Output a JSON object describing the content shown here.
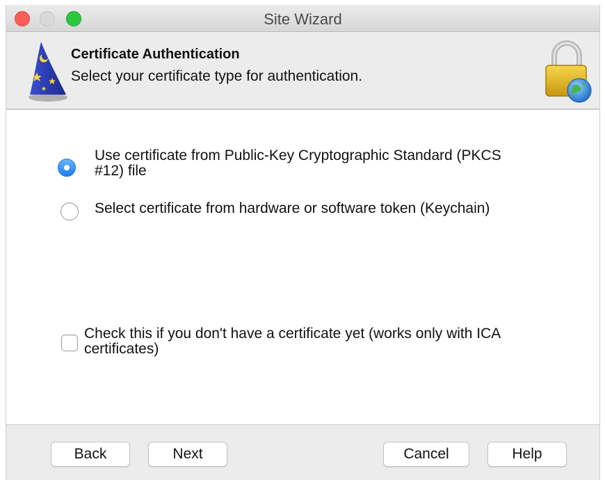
{
  "window": {
    "title": "Site Wizard"
  },
  "header": {
    "title": "Certificate Authentication",
    "subtitle": "Select your certificate type for authentication.",
    "left_icon": "wizard-hat-icon",
    "right_icon": "padlock-globe-icon"
  },
  "options": [
    {
      "line1": "Use certificate from Public-Key Cryptographic Standard (PKCS",
      "line2": "#12) file",
      "selected": true
    },
    {
      "line1": "Select certificate from hardware or software token (Keychain)",
      "selected": false
    }
  ],
  "checkbox": {
    "line1": "Check this if you don't have a certificate yet (works only with ICA",
    "line2": "certificates)",
    "checked": false
  },
  "footer": {
    "back_label": "Back",
    "next_label": "Next",
    "cancel_label": "Cancel",
    "help_label": "Help"
  },
  "colors": {
    "accent": "#1c7cf2",
    "close": "#fc5f57",
    "maximize": "#2bc840"
  }
}
